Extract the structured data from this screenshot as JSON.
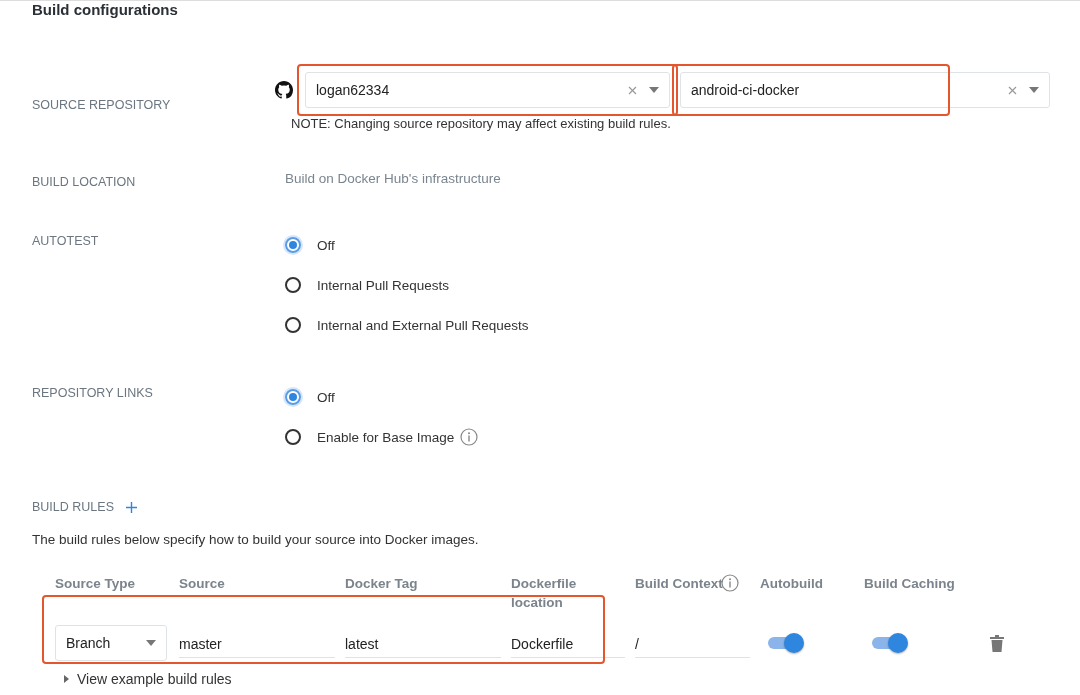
{
  "title": "Build configurations",
  "source_repository": {
    "label": "SOURCE REPOSITORY",
    "owner": {
      "value": "logan62334",
      "highlighted": true
    },
    "repository": {
      "value": "android-ci-docker",
      "highlighted": true
    },
    "note": "NOTE: Changing source repository may affect existing build rules."
  },
  "build_location": {
    "label": "BUILD LOCATION",
    "value": "Build on Docker Hub's infrastructure"
  },
  "autotest": {
    "label": "AUTOTEST",
    "options": [
      {
        "label": "Off",
        "selected": true,
        "info": false
      },
      {
        "label": "Internal Pull Requests",
        "selected": false,
        "info": false
      },
      {
        "label": "Internal and External Pull Requests",
        "selected": false,
        "info": false
      }
    ]
  },
  "repository_links": {
    "label": "REPOSITORY LINKS",
    "options": [
      {
        "label": "Off",
        "selected": true,
        "info": false
      },
      {
        "label": "Enable for Base Image",
        "selected": false,
        "info": true
      }
    ]
  },
  "build_rules": {
    "label": "BUILD RULES",
    "description": "The build rules below specify how to build your source into Docker images.",
    "columns": [
      {
        "label": "Source Type",
        "info": false
      },
      {
        "label": "Source",
        "info": false
      },
      {
        "label": "Docker Tag",
        "info": false
      },
      {
        "label": "Dockerfile location",
        "info": false
      },
      {
        "label": "Build Context",
        "info": true
      },
      {
        "label": "Autobuild",
        "info": false
      },
      {
        "label": "Build Caching",
        "info": false
      }
    ],
    "rules": [
      {
        "source_type": "Branch",
        "source": "master",
        "docker_tag": "latest",
        "dockerfile_location": "Dockerfile",
        "build_context": "/",
        "autobuild": true,
        "build_caching": true,
        "highlighted": true
      }
    ],
    "view_example": "View example build rules"
  }
}
